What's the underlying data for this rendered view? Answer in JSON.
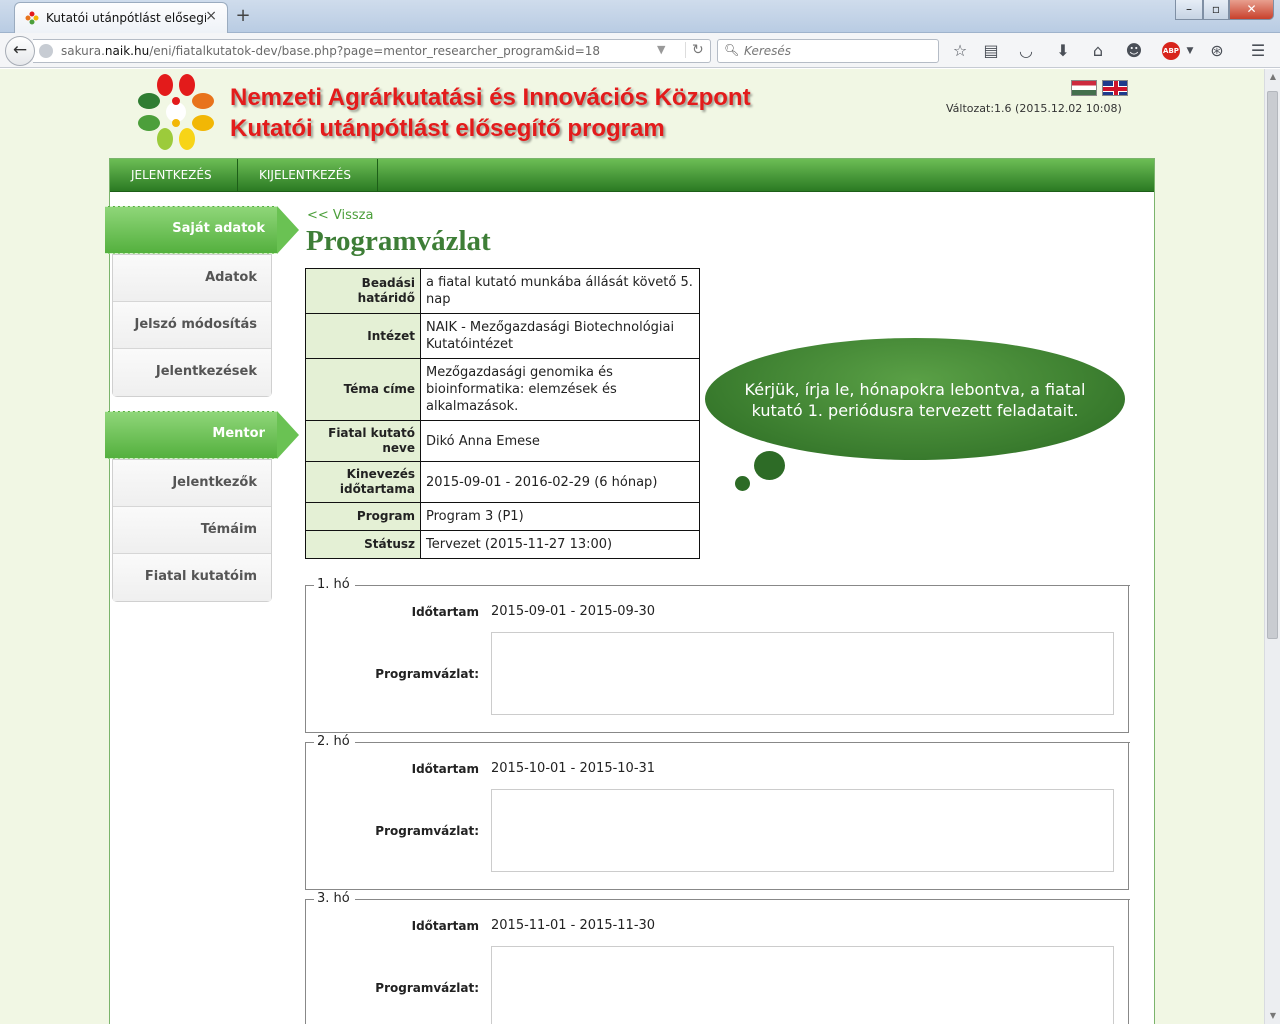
{
  "browser": {
    "tab_title": "Kutatói utánpótlást elősegí...",
    "tab_close": "×",
    "new_tab": "+",
    "url_prefix": "sakura.",
    "url_domain": "naik.hu",
    "url_path": "/eni/fiatalkutatok-dev/base.php?page=mentor_researcher_program&id=18",
    "search_placeholder": "Keresés",
    "abp_label": "ABP"
  },
  "header": {
    "brand_line1": "Nemzeti Agrárkutatási és Innovációs Központ",
    "brand_line2": "Kutatói utánpótlást elősegítő program",
    "version": "Változat:1.6 (2015.12.02 10:08)"
  },
  "menu": {
    "items": [
      "JELENTKEZÉS",
      "KIJELENTKEZÉS"
    ]
  },
  "sidebar": {
    "section1": {
      "title": "Saját adatok",
      "items": [
        "Adatok",
        "Jelszó módosítás",
        "Jelentkezések"
      ]
    },
    "section2": {
      "title": "Mentor",
      "items": [
        "Jelentkezők",
        "Témáim",
        "Fiatal kutatóim"
      ]
    }
  },
  "content": {
    "back_link": "<< Vissza",
    "title": "Programvázlat",
    "info": [
      {
        "label": "Beadási határidő",
        "value": "a fiatal kutató munkába állását követő 5. nap"
      },
      {
        "label": "Intézet",
        "value": "NAIK - Mezőgazdasági Biotechnológiai Kutatóintézet"
      },
      {
        "label": "Téma címe",
        "value": "Mezőgazdasági genomika és bioinformatika: elemzések és alkalmazások."
      },
      {
        "label": "Fiatal kutató neve",
        "value": "Dikó Anna Emese"
      },
      {
        "label": "Kinevezés időtartama",
        "value": "2015-09-01 - 2016-02-29 (6 hónap)"
      },
      {
        "label": "Program",
        "value": "Program 3 (P1)"
      },
      {
        "label": "Státusz",
        "value": "Tervezet (2015-11-27 13:00)"
      }
    ],
    "cloud_text": "Kérjük, írja le, hónapokra lebontva, a fiatal kutató 1. periódusra tervezett feladatait.",
    "duration_label": "Időtartam",
    "program_label": "Programvázlat:",
    "months": [
      {
        "legend": "1. hó",
        "duration": "2015-09-01 - 2015-09-30",
        "text": ""
      },
      {
        "legend": "2. hó",
        "duration": "2015-10-01 - 2015-10-31",
        "text": ""
      },
      {
        "legend": "3. hó",
        "duration": "2015-11-01 - 2015-11-30",
        "text": ""
      }
    ]
  },
  "colors": {
    "brand_red": "#e31b1b",
    "menu_green": "#2b7a23",
    "title_green": "#3e7e37",
    "page_bg": "#f1f7e4"
  },
  "icons": [
    "back-arrow-icon",
    "globe-icon",
    "reload-icon",
    "search-icon",
    "bookmark-star-icon",
    "reading-list-icon",
    "pocket-icon",
    "download-icon",
    "home-icon",
    "smiley-icon",
    "adblock-icon",
    "web-icon",
    "hamburger-menu-icon"
  ]
}
